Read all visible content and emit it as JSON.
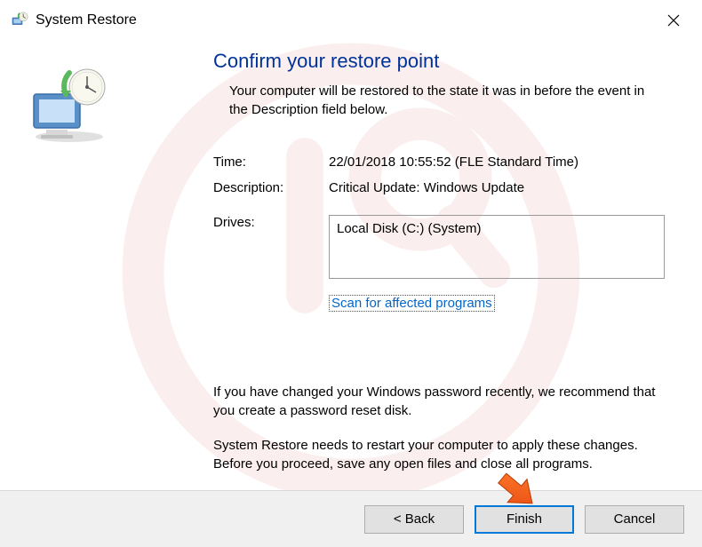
{
  "window": {
    "title": "System Restore"
  },
  "heading": "Confirm your restore point",
  "subheading": "Your computer will be restored to the state it was in before the event in the Description field below.",
  "fields": {
    "time_label": "Time:",
    "time_value": "22/01/2018 10:55:52 (FLE Standard Time)",
    "description_label": "Description:",
    "description_value": "Critical Update: Windows Update",
    "drives_label": "Drives:",
    "drives_value": "Local Disk (C:) (System)"
  },
  "link": {
    "scan_label": "Scan for affected programs"
  },
  "notes": {
    "password": "If you have changed your Windows password recently, we recommend that you create a password reset disk.",
    "restart": "System Restore needs to restart your computer to apply these changes. Before you proceed, save any open files and close all programs."
  },
  "buttons": {
    "back": "< Back",
    "finish": "Finish",
    "cancel": "Cancel"
  }
}
